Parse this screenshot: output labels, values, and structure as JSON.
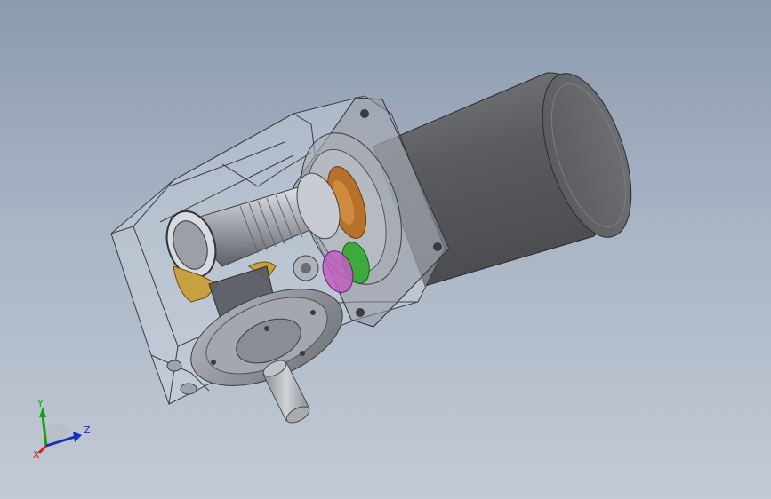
{
  "viewport": {
    "title": "",
    "model_parts": [
      "motor-can",
      "motor-mount-flange",
      "gearbox-housing",
      "worm-shaft",
      "worm-wheel",
      "planetary-gears",
      "output-flange",
      "output-shaft"
    ]
  },
  "triad": {
    "x_label": "X",
    "y_label": "Y",
    "z_label": "Z",
    "x_color": "#d42020",
    "y_color": "#18a018",
    "z_color": "#1830c0"
  },
  "colors": {
    "background_top": "#8c9bb0",
    "background_bottom": "#c3cad5",
    "motor_body": "#5e6064",
    "gear_copper": "#b8702a",
    "gear_green": "#3caa3c",
    "gear_magenta": "#c060c0",
    "worm_wheel_gold": "#c8a040"
  }
}
